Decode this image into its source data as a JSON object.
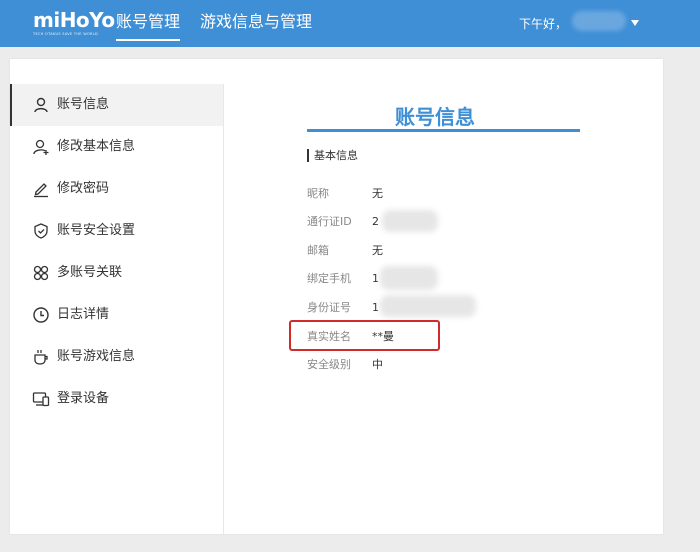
{
  "header": {
    "logo_text": "miHoYo",
    "logo_tagline": "TECH OTAKUS SAVE THE WORLD",
    "nav": [
      {
        "label": "账号管理"
      },
      {
        "label": "游戏信息与管理"
      }
    ],
    "greeting": "下午好，"
  },
  "sidebar": {
    "items": [
      {
        "label": "账号信息",
        "icon": "user-icon"
      },
      {
        "label": "修改基本信息",
        "icon": "user-plus-icon"
      },
      {
        "label": "修改密码",
        "icon": "pen-icon"
      },
      {
        "label": "账号安全设置",
        "icon": "shield-check-icon"
      },
      {
        "label": "多账号关联",
        "icon": "grid-icon"
      },
      {
        "label": "日志详情",
        "icon": "clock-icon"
      },
      {
        "label": "账号游戏信息",
        "icon": "cup-icon"
      },
      {
        "label": "登录设备",
        "icon": "devices-icon"
      }
    ]
  },
  "main": {
    "title": "账号信息",
    "section": "基本信息",
    "fields": [
      {
        "label": "昵称",
        "value": "无"
      },
      {
        "label": "通行证ID",
        "value": "2"
      },
      {
        "label": "邮箱",
        "value": "无"
      },
      {
        "label": "绑定手机",
        "value": "1"
      },
      {
        "label": "身份证号",
        "value": "1"
      },
      {
        "label": "真实姓名",
        "value": "**曼"
      },
      {
        "label": "安全级别",
        "value": "中"
      }
    ]
  },
  "colors": {
    "brand": "#3f8fd6",
    "highlight": "#d12a2a"
  }
}
